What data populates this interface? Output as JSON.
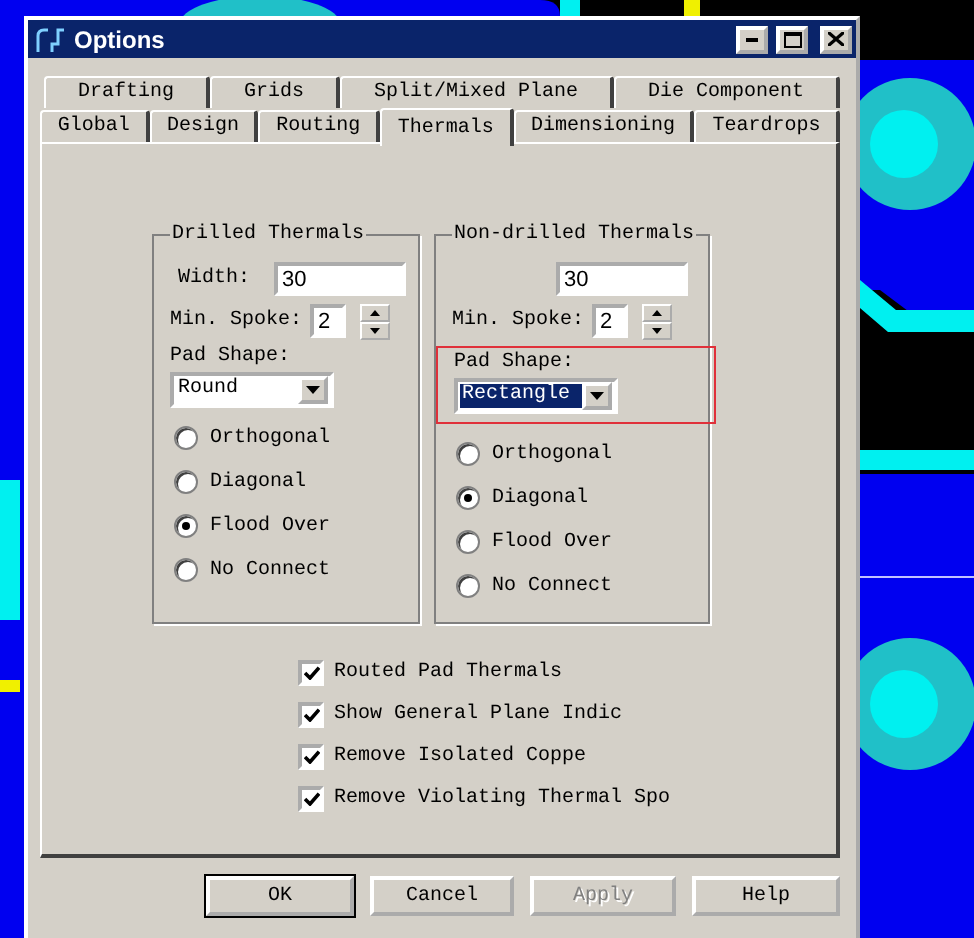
{
  "window": {
    "title": "Options"
  },
  "tabs": [
    [
      {
        "label": "Drafting",
        "selected": false
      },
      {
        "label": "Grids",
        "selected": false
      },
      {
        "label": "Split/Mixed Plane",
        "selected": false
      },
      {
        "label": "Die Component",
        "selected": false
      }
    ],
    [
      {
        "label": "Global",
        "selected": false
      },
      {
        "label": "Design",
        "selected": false
      },
      {
        "label": "Routing",
        "selected": false
      },
      {
        "label": "Thermals",
        "selected": true
      },
      {
        "label": "Dimensioning",
        "selected": false
      },
      {
        "label": "Teardrops",
        "selected": false
      }
    ]
  ],
  "groups": [
    {
      "title": "Drilled Thermals",
      "width": {
        "label": "Width:",
        "value": "30"
      },
      "spoke": {
        "label": "Min. Spoke:",
        "value": "2"
      },
      "pad_shape": {
        "label": "Pad Shape:",
        "value": "Round",
        "focused": false,
        "annotated": false
      },
      "options": [
        {
          "label": "Orthogonal",
          "selected": false
        },
        {
          "label": "Diagonal",
          "selected": false
        },
        {
          "label": "Flood Over",
          "selected": true
        },
        {
          "label": "No Connect",
          "selected": false
        }
      ]
    },
    {
      "title": "Non-drilled Thermals",
      "width": {
        "value": "30"
      },
      "spoke": {
        "label": "Min. Spoke:",
        "value": "2"
      },
      "pad_shape": {
        "label": "Pad Shape:",
        "value": "Rectangle",
        "focused": true,
        "annotated": true
      },
      "options": [
        {
          "label": "Orthogonal",
          "selected": false
        },
        {
          "label": "Diagonal",
          "selected": true
        },
        {
          "label": "Flood Over",
          "selected": false
        },
        {
          "label": "No Connect",
          "selected": false
        }
      ]
    }
  ],
  "checkboxes": [
    {
      "label": "Routed Pad Thermals",
      "checked": true
    },
    {
      "label": "Show General Plane Indic",
      "checked": true
    },
    {
      "label": "Remove Isolated Coppe",
      "checked": true
    },
    {
      "label": "Remove Violating Thermal Spo",
      "checked": true
    }
  ],
  "buttons": [
    {
      "label": "OK",
      "default": true,
      "disabled": false
    },
    {
      "label": "Cancel",
      "default": false,
      "disabled": false
    },
    {
      "label": "Apply",
      "default": false,
      "disabled": true
    },
    {
      "label": "Help",
      "default": false,
      "disabled": false
    }
  ]
}
